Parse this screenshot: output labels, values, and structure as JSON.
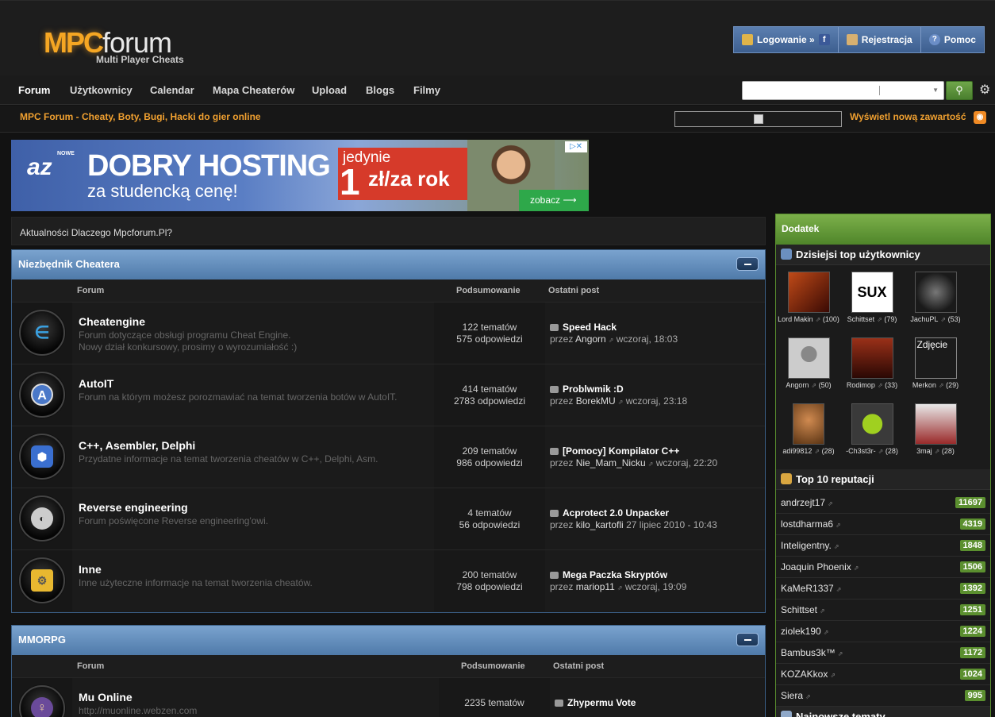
{
  "logo": {
    "mpc": "MPC",
    "forum": "forum",
    "tagline": "Multi Player Cheats"
  },
  "userbar": {
    "login": "Logowanie »",
    "register": "Rejestracja",
    "help": "Pomoc"
  },
  "nav": [
    "Forum",
    "Użytkownicy",
    "Calendar",
    "Mapa Cheaterów",
    "Upload",
    "Blogs",
    "Filmy"
  ],
  "subbar": {
    "tagline": "MPC Forum - Cheaty, Boty, Bugi, Hacki do gier online",
    "new_content": "Wyświetl nową zawartość"
  },
  "ad": {
    "brand": "az",
    "brand_small": "NOWE",
    "headline": "DOBRY HOSTING",
    "sub": "za studencką cenę!",
    "price_top": "jedynie",
    "price_num": "1",
    "price_unit": "zł/za rok",
    "cta": "zobacz ⟶"
  },
  "news": "Aktualności Dlaczego Mpcforum.Pl?",
  "categories": [
    {
      "title": "Niezbędnik Cheatera",
      "col_forum": "Forum",
      "col_summary": "Podsumowanie",
      "col_last": "Ostatni post",
      "forums": [
        {
          "title": "Cheatengine",
          "desc1": "Forum dotyczące obsługi programu Cheat Engine.",
          "desc2": "Nowy dział konkursowy, prosimy o wyrozumiałość :)",
          "topics": "122 tematów",
          "replies": "575 odpowiedzi",
          "last_title": "Speed Hack",
          "by": "przez",
          "last_user": "Angorn",
          "last_time": "wczoraj, 18:03",
          "icon": "cheatengine-icon"
        },
        {
          "title": "AutoIT",
          "desc1": "Forum na którym możesz porozmawiać na temat tworzenia botów w AutoIT.",
          "desc2": "",
          "topics": "414 tematów",
          "replies": "2783 odpowiedzi",
          "last_title": "Problwmik :D",
          "by": "przez",
          "last_user": "BorekMU",
          "last_time": "wczoraj, 23:18",
          "icon": "autoit-icon"
        },
        {
          "title": "C++, Asembler, Delphi",
          "desc1": "Przydatne informacje na temat tworzenia cheatów w C++, Delphi, Asm.",
          "desc2": "",
          "topics": "209 tematów",
          "replies": "986 odpowiedzi",
          "last_title": "[Pomocy] Kompilator C++",
          "by": "przez",
          "last_user": "Nie_Mam_Nicku",
          "last_time": "wczoraj, 22:20",
          "icon": "cpp-icon"
        },
        {
          "title": "Reverse engineering",
          "desc1": "Forum poświęcone Reverse engineering'owi.",
          "desc2": "",
          "topics": "4 tematów",
          "replies": "56 odpowiedzi",
          "last_title": "Acprotect 2.0 Unpacker",
          "by": "przez",
          "last_user": "kilo_kartofli",
          "last_time": "27 lipiec 2010 - 10:43",
          "icon": "reverse-engineering-icon"
        },
        {
          "title": "Inne",
          "desc1": "Inne użyteczne informacje na temat tworzenia cheatów.",
          "desc2": "",
          "topics": "200 tematów",
          "replies": "798 odpowiedzi",
          "last_title": "Mega Paczka Skryptów",
          "by": "przez",
          "last_user": "mariop11",
          "last_time": "wczoraj, 19:09",
          "icon": "other-icon"
        }
      ]
    },
    {
      "title": "MMORPG",
      "col_forum": "Forum",
      "col_summary": "Podsumowanie",
      "col_last": "Ostatni post",
      "forums": [
        {
          "title": "Mu Online",
          "desc1": "http://muonline.webzen.com",
          "desc2": "",
          "topics": "2235 tematów",
          "replies": "",
          "last_title": "Zhypermu Vote",
          "by": "",
          "last_user": "",
          "last_time": "",
          "icon": "mu-online-icon"
        }
      ]
    }
  ],
  "sidebar": {
    "title": "Dodatek",
    "top_users_title": "Dzisiejsi top użytkownicy",
    "top_users": [
      {
        "name": "Lord Makin",
        "count": "(100)",
        "color": "#8a2a14"
      },
      {
        "name": "Schittset",
        "count": "(79)",
        "color": "#ffffff"
      },
      {
        "name": "JachuPL",
        "count": "(53)",
        "color": "#2a2a2a"
      },
      {
        "name": "Angorn",
        "count": "(50)",
        "color": "#cfcfcf"
      },
      {
        "name": "Rodimop",
        "count": "(33)",
        "color": "#5a2014"
      },
      {
        "name": "Merkon",
        "count": "(29)",
        "color": "#1b1b1b"
      },
      {
        "name": "adi99812",
        "count": "(28)",
        "color": "#b8743a"
      },
      {
        "name": "-Ch3st3r-",
        "count": "(28)",
        "color": "#3a3a3a"
      },
      {
        "name": "3maj",
        "count": "(28)",
        "color": "#c9c9c9"
      }
    ],
    "sux_text": "SUX",
    "zdjecie": "Zdjęcie",
    "rep_title": "Top 10 reputacji",
    "reputation": [
      {
        "name": "andrzejt17",
        "value": "11697"
      },
      {
        "name": "lostdharma6",
        "value": "4319"
      },
      {
        "name": "Inteligentny.",
        "value": "1848"
      },
      {
        "name": "Joaquin Phoenix",
        "value": "1506"
      },
      {
        "name": "KaMeR1337",
        "value": "1392"
      },
      {
        "name": "Schittset",
        "value": "1251"
      },
      {
        "name": "ziolek190",
        "value": "1224"
      },
      {
        "name": "Bambus3k™",
        "value": "1172"
      },
      {
        "name": "KOZAKkox",
        "value": "1024"
      },
      {
        "name": "Siera",
        "value": "995"
      }
    ],
    "newest_title": "Najnowsze tematy"
  }
}
